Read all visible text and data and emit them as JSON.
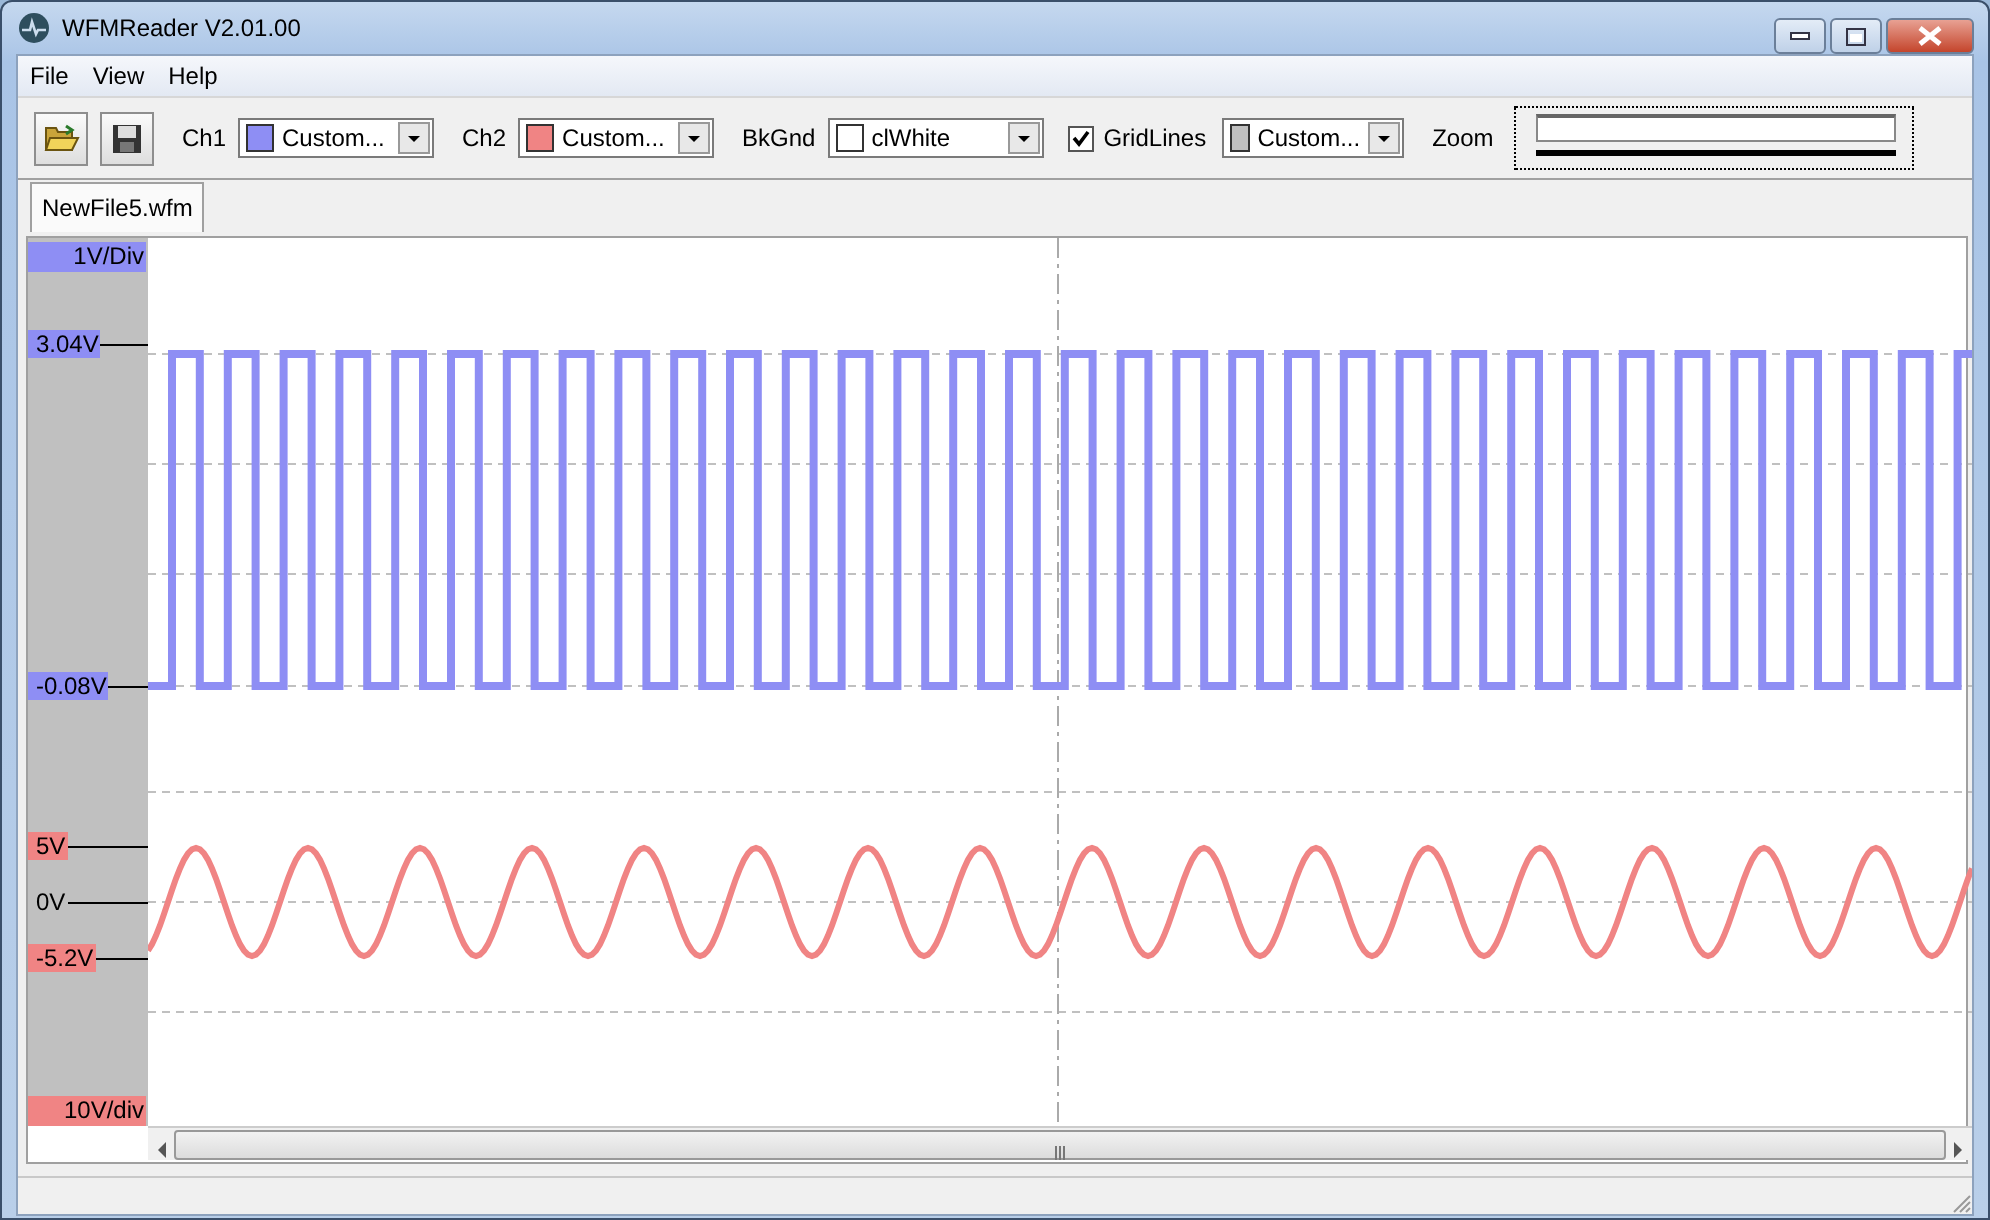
{
  "window": {
    "title": "WFMReader V2.01.00"
  },
  "menu": [
    "File",
    "View",
    "Help"
  ],
  "toolbar": {
    "combos": [
      {
        "label": "Ch1",
        "color": "#8e8ef4",
        "value": "Custom..."
      },
      {
        "label": "Ch2",
        "color": "#f08484",
        "value": "Custom..."
      },
      {
        "label": "BkGnd",
        "color": "#ffffff",
        "value": "clWhite"
      }
    ],
    "gridlines": {
      "label": "GridLines",
      "checked": true,
      "color": "#c0c0c0",
      "value": "Custom..."
    },
    "zoom": {
      "label": "Zoom",
      "level": 1
    }
  },
  "tabs": [
    {
      "label": "NewFile5.wfm",
      "selected": true
    }
  ],
  "channels": [
    {
      "color": "#8e8ef4",
      "scale": "1V/Div",
      "markers": [
        {
          "label": "3.04V",
          "kind": "level"
        },
        {
          "label": "-0.08V",
          "kind": "level"
        }
      ]
    },
    {
      "color": "#f08484",
      "scale": "10V/div",
      "markers": [
        {
          "label": "5V",
          "kind": "level"
        },
        {
          "label": "0V",
          "kind": "zero"
        },
        {
          "label": "-5.2V",
          "kind": "level"
        }
      ]
    }
  ]
}
